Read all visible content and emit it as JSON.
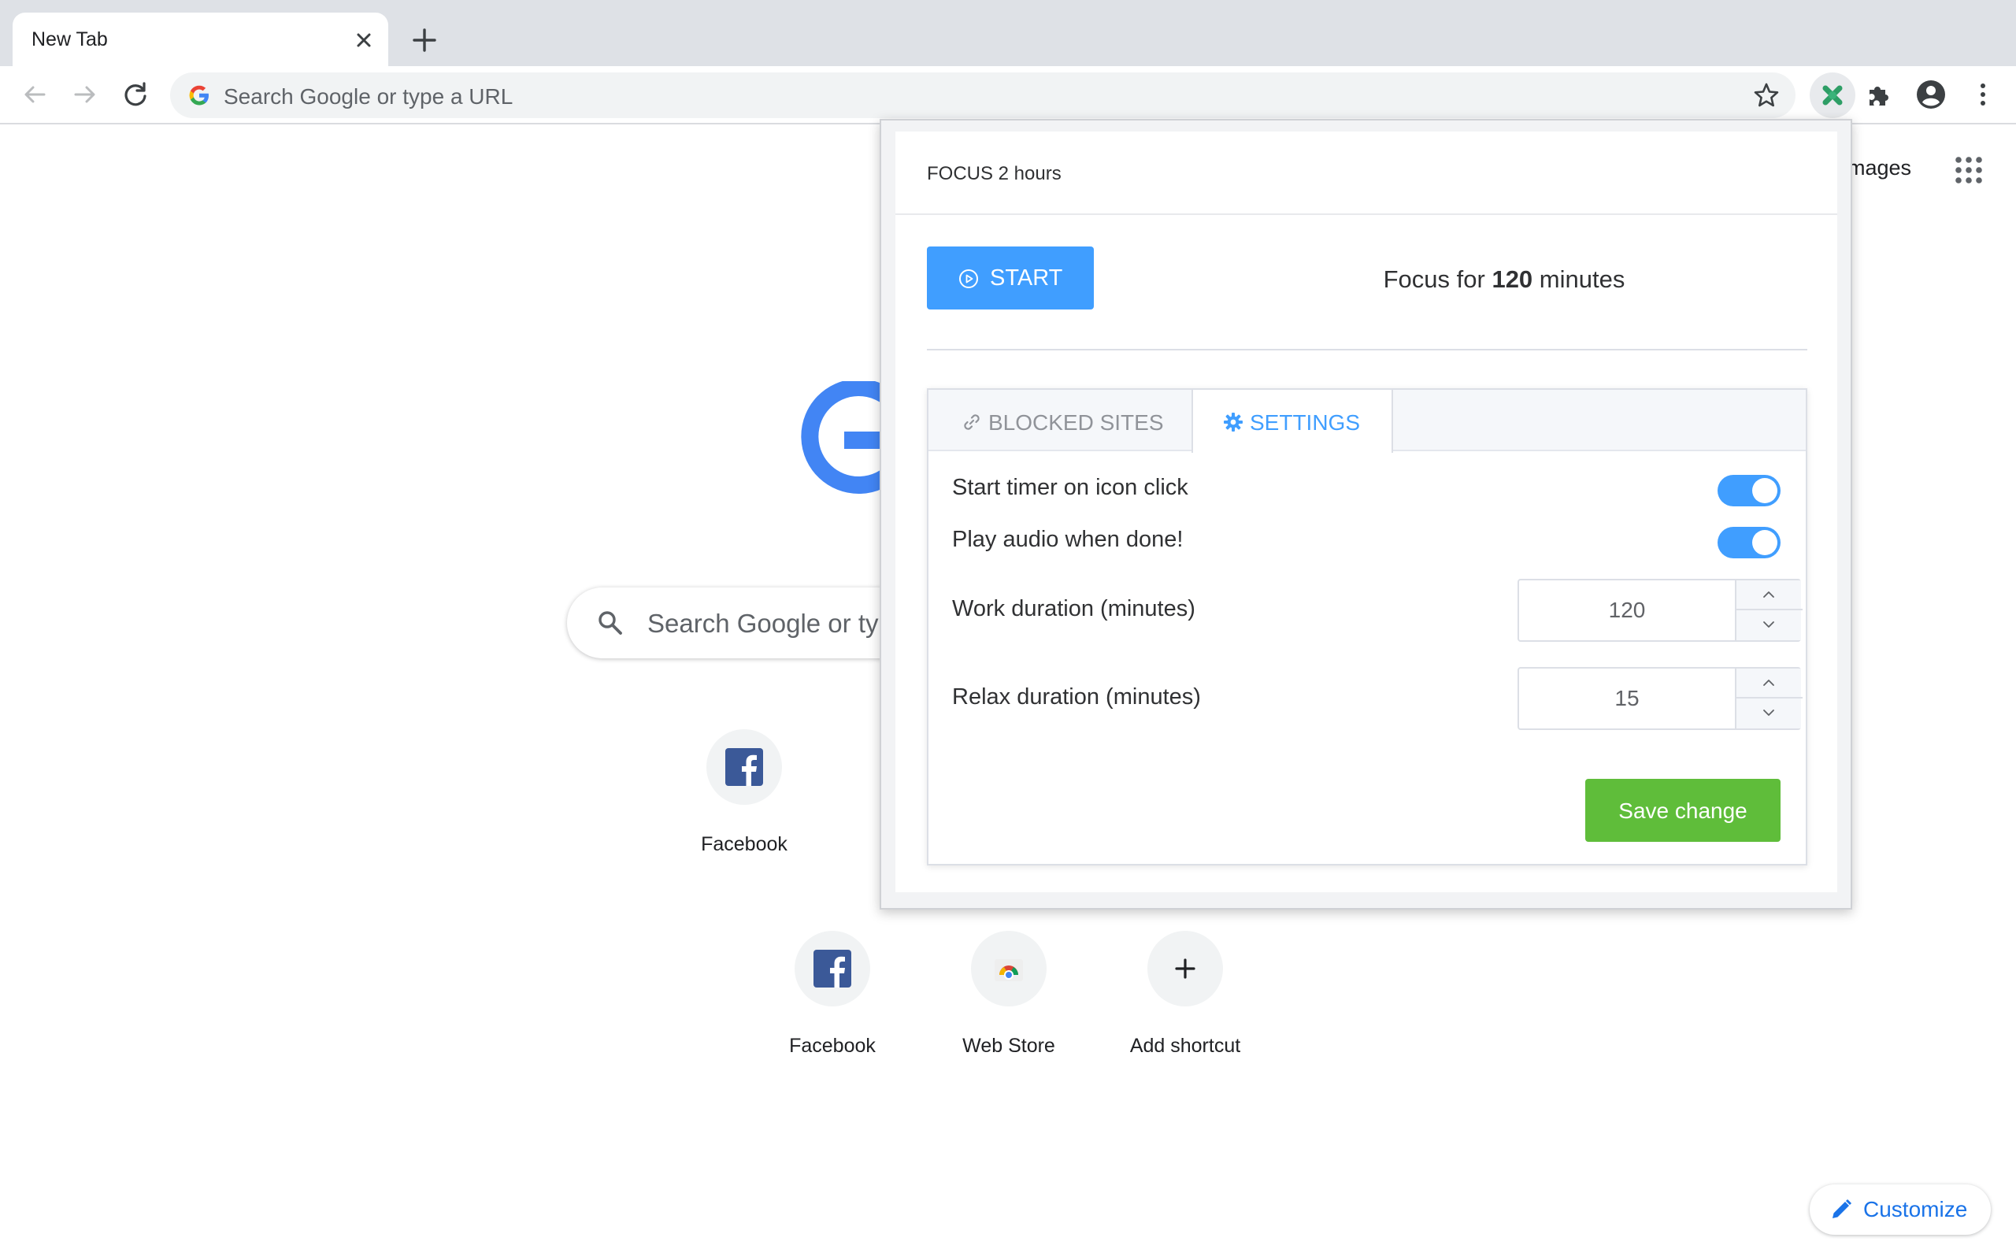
{
  "browser": {
    "tab_title": "New Tab",
    "omnibox_placeholder": "Search Google or type a URL"
  },
  "ntp": {
    "images_link": "mages",
    "search_placeholder": "Search Google or typ",
    "shortcuts_row1": [
      {
        "label": "Facebook",
        "icon": "facebook-icon"
      }
    ],
    "shortcuts_row2": [
      {
        "label": "Facebook",
        "icon": "facebook-icon"
      },
      {
        "label": "Web Store",
        "icon": "web-store-icon"
      },
      {
        "label": "Add shortcut",
        "icon": "plus-icon"
      }
    ],
    "customize_label": "Customize"
  },
  "popup": {
    "title": "FOCUS 2 hours",
    "start_label": "START",
    "focus_prefix": "Focus for ",
    "focus_minutes": "120",
    "focus_suffix": " minutes",
    "tabs": [
      {
        "label": "BLOCKED SITES",
        "icon": "link-icon",
        "active": false
      },
      {
        "label": "SETTINGS",
        "icon": "gear-icon",
        "active": true
      }
    ],
    "settings": {
      "start_timer_label": "Start timer on icon click",
      "start_timer_on": true,
      "play_audio_label": "Play audio when done!",
      "play_audio_on": true,
      "work_label": "Work duration (minutes)",
      "work_value": "120",
      "relax_label": "Relax duration (minutes)",
      "relax_value": "15"
    },
    "save_label": "Save change"
  },
  "colors": {
    "primary": "#409eff",
    "success": "#5fbd3a",
    "link": "#1a73e8"
  }
}
